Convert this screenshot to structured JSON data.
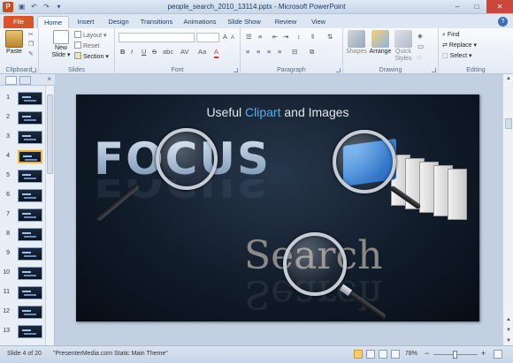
{
  "window": {
    "title": "people_search_2010_13114.pptx - Microsoft PowerPoint",
    "controls": [
      "–",
      "□",
      "✕"
    ]
  },
  "ribbon_tabs": [
    "File",
    "Home",
    "Insert",
    "Design",
    "Transitions",
    "Animations",
    "Slide Show",
    "Review",
    "View"
  ],
  "ribbon": {
    "clipboard": {
      "paste": "Paste",
      "label": "Clipboard"
    },
    "slides": {
      "new_slide": "New Slide",
      "new_slide_arrow": "▾",
      "layout": "Layout",
      "layout_arrow": "▾",
      "reset": "Reset",
      "section": "Section",
      "section_arrow": "▾",
      "label": "Slides"
    },
    "font": {
      "label": "Font",
      "grow": "A",
      "shrink": "A",
      "clear": "A",
      "bold": "B",
      "italic": "I",
      "underline": "U",
      "strike": "S",
      "shadow": "abc",
      "spacing": "AV",
      "case": "Aa",
      "color": "A"
    },
    "paragraph": {
      "label": "Paragraph"
    },
    "drawing": {
      "shapes": "Shapes",
      "arrange": "Arrange",
      "quick_styles": "Quick Styles",
      "label": "Drawing"
    },
    "editing": {
      "find": "Find",
      "replace": "Replace",
      "replace_arrow": "▾",
      "select": "Select",
      "select_arrow": "▾",
      "label": "Editing"
    }
  },
  "slides_pane": {
    "close": "×",
    "thumbnails": [
      "1",
      "2",
      "3",
      "4",
      "5",
      "6",
      "7",
      "8",
      "9",
      "10",
      "11",
      "12",
      "13"
    ],
    "selected": "4"
  },
  "slide": {
    "title_pre": "Useful ",
    "title_highlight": "Clipart",
    "title_post": " and Images",
    "word_focus": "FOCUS",
    "word_search": "Search"
  },
  "statusbar": {
    "slide_info": "Slide 4 of 20",
    "theme": "\"PresenterMedia.com Static Main Theme\"",
    "zoom": "78%",
    "zoom_out": "−",
    "zoom_in": "+"
  },
  "colors": {
    "file_tab": "#d95428",
    "title_highlight": "#5aaeea",
    "close_button": "#c9483b"
  }
}
